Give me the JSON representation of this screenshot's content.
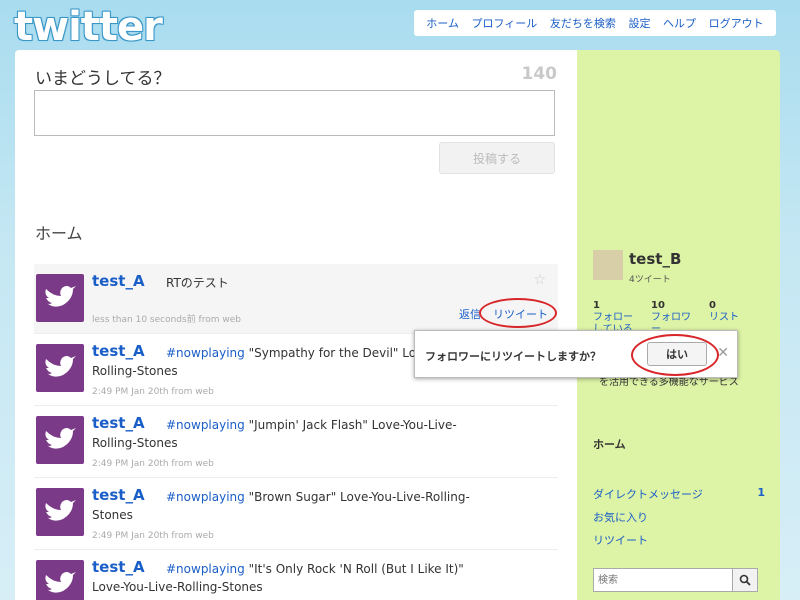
{
  "header": {
    "logo": "twitter",
    "nav": [
      "ホーム",
      "プロフィール",
      "友だちを検索",
      "設定",
      "ヘルプ",
      "ログアウト"
    ]
  },
  "composer": {
    "prompt": "いまどうしてる？",
    "counter": "140",
    "post_button": "投稿する"
  },
  "timeline": {
    "heading": "ホーム",
    "tweets": [
      {
        "name": "test_A",
        "hashtag": "",
        "text": "RTのテスト",
        "meta": "less than 10 seconds前 from web"
      },
      {
        "name": "test_A",
        "hashtag": "#nowplaying",
        "text": " \"Sympathy for the Devil\" Love-You-Live-Rolling-Stones",
        "meta": "2:49 PM Jan 20th from web"
      },
      {
        "name": "test_A",
        "hashtag": "#nowplaying",
        "text": " \"Jumpin' Jack Flash\" Love-You-Live-Rolling-Stones",
        "meta": "2:49 PM Jan 20th from web"
      },
      {
        "name": "test_A",
        "hashtag": "#nowplaying",
        "text": " \"Brown Sugar\" Love-You-Live-Rolling-Stones",
        "meta": "2:49 PM Jan 20th from web"
      },
      {
        "name": "test_A",
        "hashtag": "#nowplaying",
        "text": " \"It's Only Rock 'N Roll (But I Like It)\" Love-You-Live-Rolling-Stones",
        "meta": ""
      }
    ],
    "actions": {
      "reply": "返信",
      "retweet": "リツイート"
    }
  },
  "dialog": {
    "question": "フォロワーにリツイートしますか？",
    "yes": "はい"
  },
  "sidebar": {
    "profile_name": "test_B",
    "profile_tweets": "4ツイート",
    "stats": [
      {
        "num": "1",
        "label": "フォローしている"
      },
      {
        "num": "10",
        "label": "フォロワー"
      },
      {
        "num": "0",
        "label": "リスト"
      }
    ],
    "bio": "を活用できる多機能なサービス",
    "home": "ホーム",
    "links": [
      {
        "label": "ダイレクトメッセージ",
        "count": "1"
      },
      {
        "label": "お気に入り",
        "count": ""
      },
      {
        "label": "リツイート",
        "count": ""
      }
    ],
    "search_placeholder": "検索"
  }
}
